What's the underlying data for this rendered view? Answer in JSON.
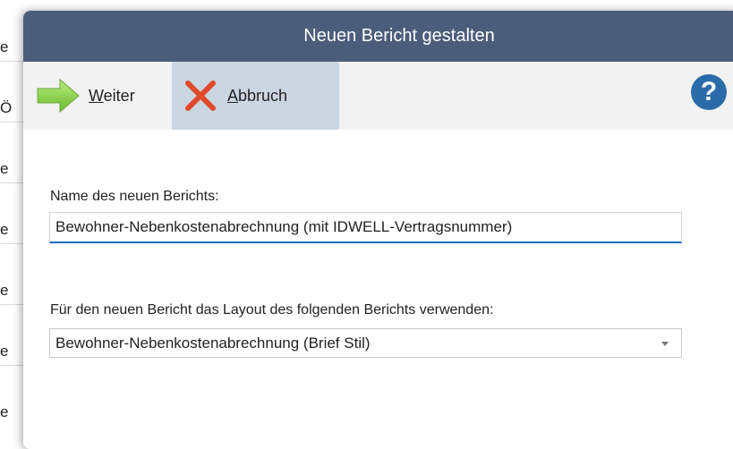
{
  "background": {
    "rows": [
      "e",
      "Ö",
      "e",
      "e",
      "e",
      "e",
      "e"
    ]
  },
  "dialog": {
    "title": "Neuen Bericht gestalten",
    "toolbar": {
      "next": {
        "mnemonic": "W",
        "rest": "eiter",
        "icon": "arrow-right-icon"
      },
      "cancel": {
        "mnemonic": "A",
        "rest": "bbruch",
        "icon": "close-x-icon"
      },
      "help_label": "?"
    },
    "name_label": "Name des neuen Berichts:",
    "name_value": "Bewohner-Nebenkostenabrechnung (mit IDWELL-Vertragsnummer)",
    "layout_label": "Für den neuen Bericht das Layout des folgenden Berichts verwenden:",
    "layout_value": "Bewohner-Nebenkostenabrechnung (Brief Stil)"
  },
  "colors": {
    "titlebar": "#4b5d7a",
    "toolbar": "#f2f2f2",
    "toolbar_active": "#cbd6e3",
    "accent": "#1e6ec7",
    "help": "#2c6ba9",
    "arrow": "#8bd14b",
    "cancel_x": "#e04a2a"
  }
}
